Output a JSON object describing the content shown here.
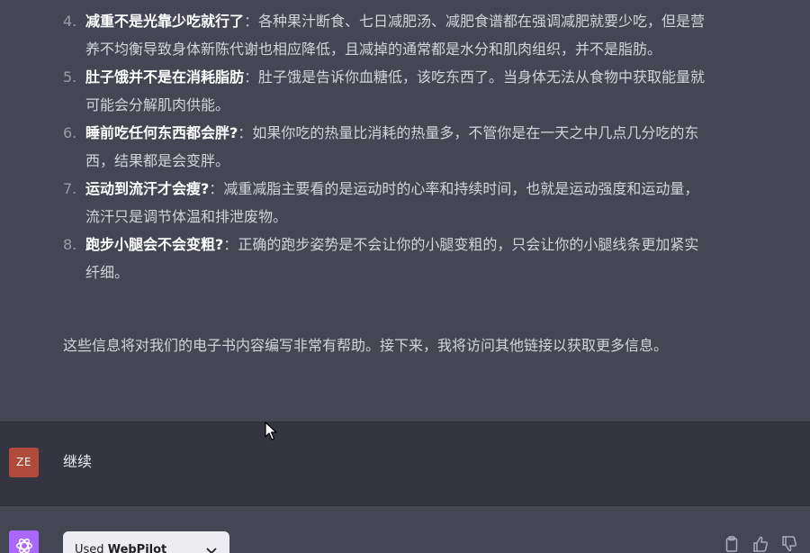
{
  "assistant": {
    "items": [
      {
        "number": "4.",
        "title": "减重不是光靠少吃就行了",
        "sep": "：",
        "text": "各种果汁断食、七日减肥汤、减肥食谱都在强调减肥就要少吃，但是营养不均衡导致身体新陈代谢也相应降低，且减掉的通常都是水分和肌肉组织，并不是脂肪。"
      },
      {
        "number": "5.",
        "title": "肚子饿并不是在消耗脂肪",
        "sep": "：",
        "text": "肚子饿是告诉你血糖低，该吃东西了。当身体无法从食物中获取能量就可能会分解肌肉供能。"
      },
      {
        "number": "6.",
        "title": "睡前吃任何东西都会胖?",
        "sep": "：",
        "text": "如果你吃的热量比消耗的热量多，不管你是在一天之中几点几分吃的东西，结果都是会变胖。"
      },
      {
        "number": "7.",
        "title": "运动到流汗才会瘦?",
        "sep": "：",
        "text": "减重减脂主要看的是运动时的心率和持续时间，也就是运动强度和运动量，流汗只是调节体温和排泄废物。"
      },
      {
        "number": "8.",
        "title": "跑步小腿会不会变粗?",
        "sep": "：",
        "text": "正确的跑步姿势是不会让你的小腿变粗的，只会让你的小腿线条更加紧实纤细。"
      }
    ],
    "summary": "这些信息将对我们的电子书内容编写非常有帮助。接下来，我将访问其他链接以获取更多信息。"
  },
  "user": {
    "avatar_text": "ZE",
    "message": "继续"
  },
  "bot": {
    "plugin_prefix": "Used",
    "plugin_name": "WebPilot"
  },
  "colors": {
    "assistant_bg": "#444654",
    "user_bg": "#343541",
    "user_avatar": "#b04a3a",
    "bot_avatar": "#ab68ff"
  },
  "icons": [
    "openai-logo-icon",
    "chevron-down-icon",
    "clipboard-icon",
    "thumbs-up-icon",
    "thumbs-down-icon",
    "mouse-cursor-icon"
  ]
}
